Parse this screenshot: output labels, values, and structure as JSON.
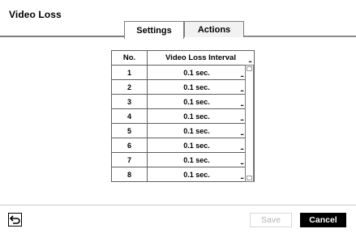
{
  "window": {
    "title": "Video Loss"
  },
  "tabs": [
    {
      "label": "Settings",
      "active": true
    },
    {
      "label": "Actions",
      "active": false
    }
  ],
  "table": {
    "headers": {
      "no": "No.",
      "interval": "Video Loss Interval"
    },
    "header_more": "...",
    "rows": [
      {
        "no": "1",
        "interval": "0.1 sec.",
        "more": "..."
      },
      {
        "no": "2",
        "interval": "0.1 sec.",
        "more": "..."
      },
      {
        "no": "3",
        "interval": "0.1 sec.",
        "more": "..."
      },
      {
        "no": "4",
        "interval": "0.1 sec.",
        "more": "..."
      },
      {
        "no": "5",
        "interval": "0.1 sec.",
        "more": "..."
      },
      {
        "no": "6",
        "interval": "0.1 sec.",
        "more": "..."
      },
      {
        "no": "7",
        "interval": "0.1 sec.",
        "more": "..."
      },
      {
        "no": "8",
        "interval": "0.1 sec.",
        "more": "..."
      }
    ]
  },
  "footer": {
    "back_icon": "back-arrow-icon",
    "save_label": "Save",
    "save_enabled": false,
    "cancel_label": "Cancel"
  }
}
